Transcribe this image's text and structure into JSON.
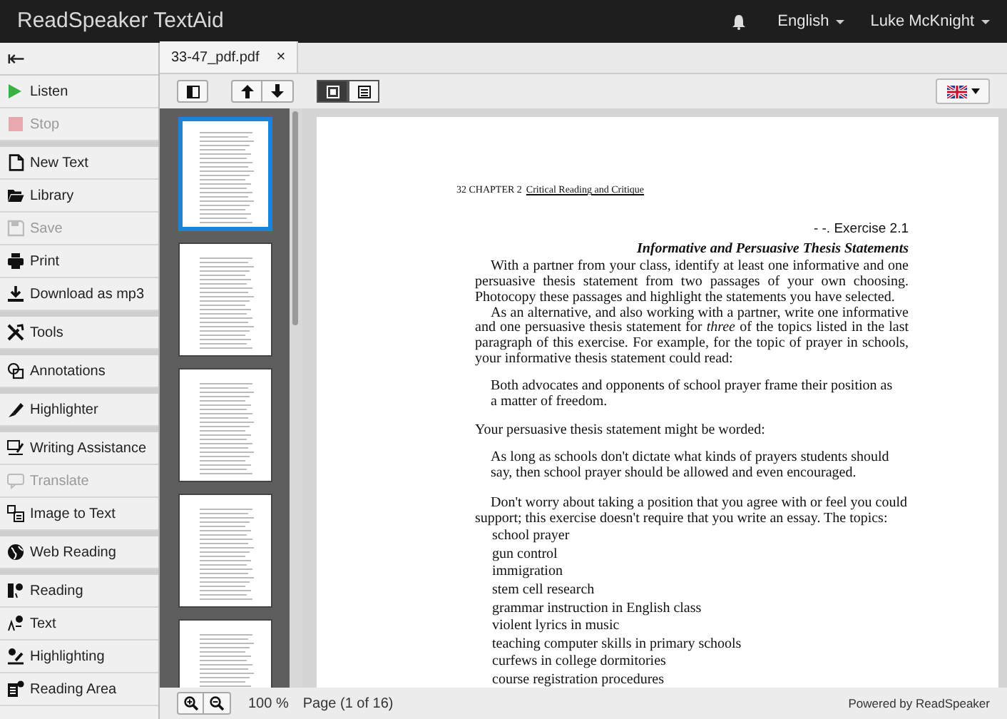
{
  "app_bar": {
    "title": "ReadSpeaker TextAid",
    "language": "English",
    "user": "Luke McKnight"
  },
  "sidebar": {
    "collapse": "⇤",
    "groups": [
      {
        "items": [
          {
            "label": "Listen",
            "disabled": false
          },
          {
            "label": "Stop",
            "disabled": true
          }
        ]
      },
      {
        "items": [
          {
            "label": "New Text",
            "disabled": false
          },
          {
            "label": "Library",
            "disabled": false
          },
          {
            "label": "Save",
            "disabled": true
          },
          {
            "label": "Print",
            "disabled": false
          },
          {
            "label": "Download as mp3",
            "disabled": false
          }
        ]
      },
      {
        "items": [
          {
            "label": "Tools",
            "disabled": false
          }
        ]
      },
      {
        "items": [
          {
            "label": "Annotations",
            "disabled": false
          }
        ]
      },
      {
        "items": [
          {
            "label": "Highlighter",
            "disabled": false
          }
        ]
      },
      {
        "items": [
          {
            "label": "Writing Assistance",
            "disabled": false
          },
          {
            "label": "Translate",
            "disabled": true
          },
          {
            "label": "Image to Text",
            "disabled": false
          }
        ]
      },
      {
        "items": [
          {
            "label": "Web Reading",
            "disabled": false
          }
        ]
      },
      {
        "items": [
          {
            "label": "Reading",
            "disabled": false
          },
          {
            "label": "Text",
            "disabled": false
          },
          {
            "label": "Highlighting",
            "disabled": false
          },
          {
            "label": "Reading Area",
            "disabled": false
          }
        ]
      }
    ]
  },
  "tab": {
    "label": "33-47_pdf.pdf",
    "close": "×"
  },
  "toolbar": {
    "view_modes": [
      {
        "selected": true
      },
      {
        "selected": false
      }
    ]
  },
  "thumbnails": [
    {
      "selected": true
    },
    {
      "selected": false
    },
    {
      "selected": false
    },
    {
      "selected": false
    },
    {
      "selected": false
    }
  ],
  "page": {
    "header_prefix": "32 CHAPTER 2",
    "header_title": "Critical Reading and Critique",
    "exercise": "- -. Exercise 2.1",
    "heading": "Informative and Persuasive Thesis Statements",
    "blocks": [
      {
        "kind": "para",
        "text": "With a partner from your class, identify at least one informative and one persuasive thesis statement from two passages of your own choosing. Photocopy these passages and highlight the statements you have selected."
      },
      {
        "kind": "para",
        "text": "As an alternative, and also working with a partner, write one informative and one persuasive thesis statement for *three* of the topics listed in the last paragraph of this exercise. For example, for the topic of prayer in schools, your informative thesis statement could read:"
      },
      {
        "kind": "quote",
        "text": "Both advocates and opponents of school prayer frame their position as a matter of freedom."
      },
      {
        "kind": "plain",
        "text": "Your persuasive thesis statement might be worded:"
      },
      {
        "kind": "quote",
        "text": "As long as schools don't dictate what kinds of prayers students should say, then school prayer should be allowed and even encouraged."
      },
      {
        "kind": "para2",
        "text": "Don't worry about taking a position that you agree with or feel you could support; this exercise doesn't require that you write an essay. The topics:"
      }
    ],
    "topics": [
      "school prayer",
      "gun control",
      "immigration",
      "stem cell research",
      "grammar instruction in English class",
      "violent lyrics in music",
      "teaching computer skills in primary schools",
      "curfews in college dormitories",
      "course registration procedures"
    ]
  },
  "footer": {
    "zoom": "100 %",
    "page": "Page (1 of 16)",
    "credit": "Powered by ReadSpeaker"
  }
}
